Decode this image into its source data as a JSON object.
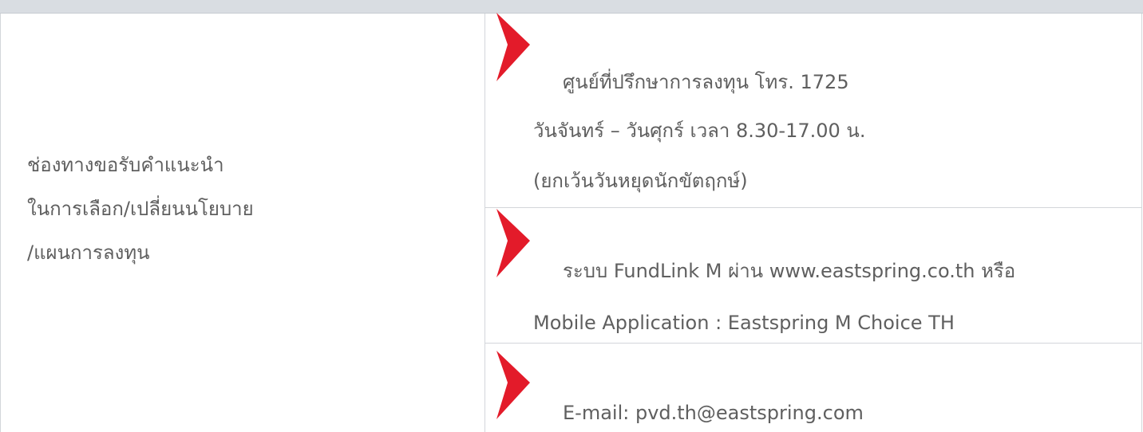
{
  "left_cell": {
    "line1": "ช่องทางขอรับคำแนะนำ",
    "line2": "ในการเลือก/เปลี่ยนนโยบาย",
    "line3": "/แผนการลงทุน"
  },
  "channels": [
    {
      "icon": "red-chevron-icon",
      "lines": [
        "ศูนย์ที่ปรึกษาการลงทุน โทร. 1725",
        "วันจันทร์ – วันศุกร์ เวลา 8.30-17.00 น.",
        "(ยกเว้นวันหยุดนักขัตฤกษ์)"
      ]
    },
    {
      "icon": "red-chevron-icon",
      "lines": [
        "ระบบ FundLink M ผ่าน www.eastspring.co.th หรือ",
        "Mobile Application : Eastspring M Choice TH"
      ]
    },
    {
      "icon": "red-chevron-icon",
      "lines": [
        "E-mail: pvd.th@eastspring.com"
      ]
    }
  ],
  "colors": {
    "accent": "#e31b2a",
    "text": "#5f5f5f",
    "header_bar": "#d9dde2",
    "border": "#d3d6da"
  }
}
